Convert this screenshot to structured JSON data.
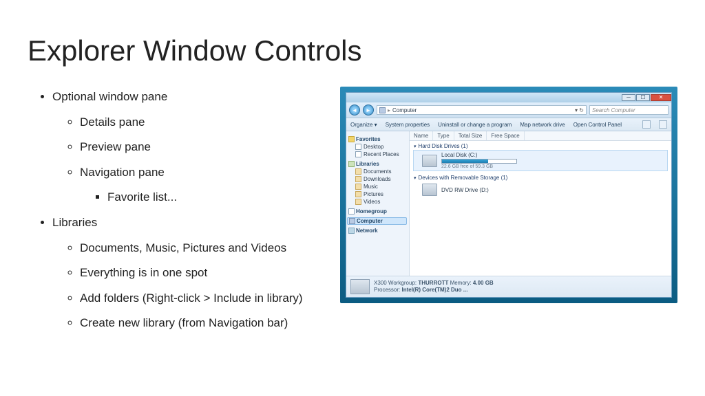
{
  "title": "Explorer Window Controls",
  "bullets": {
    "b1a": "Optional window pane",
    "b2a": "Details pane",
    "b2b": "Preview pane",
    "b2c": "Navigation pane",
    "b3a": "Favorite list...",
    "b1b": "Libraries",
    "b2d": "Documents, Music, Pictures and Videos",
    "b2e": "Everything is in one spot",
    "b2f": "Add folders (Right-click > Include in library)",
    "b2g": "Create new library (from Navigation bar)"
  },
  "explorer": {
    "addrbar": {
      "root_icon": "▸",
      "location": "Computer",
      "search_placeholder": "Search Computer"
    },
    "toolbar": {
      "organize": "Organize ▾",
      "sysprop": "System properties",
      "uninstall": "Uninstall or change a program",
      "mapdrive": "Map network drive",
      "controlpanel": "Open Control Panel"
    },
    "nav": {
      "favorites": "Favorites",
      "desktop": "Desktop",
      "recent": "Recent Places",
      "libraries": "Libraries",
      "documents": "Documents",
      "downloads": "Downloads",
      "music": "Music",
      "pictures": "Pictures",
      "videos": "Videos",
      "homegroup": "Homegroup",
      "computer": "Computer",
      "network": "Network"
    },
    "columns": {
      "name": "Name",
      "type": "Type",
      "total": "Total Size",
      "free": "Free Space"
    },
    "sections": {
      "hdd": "Hard Disk Drives (1)",
      "removable": "Devices with Removable Storage (1)"
    },
    "drives": {
      "c_label": "Local Disk (C:)",
      "c_free": "22.6 GB free of 59.3 GB",
      "c_fill_pct": 62,
      "d_label": "DVD RW Drive (D:)"
    },
    "status": {
      "line1a": "X300  Workgroup: ",
      "line1b": "THURROTT",
      "line1c": "          Memory: ",
      "line1d": "4.00 GB",
      "line2a": "Processor: ",
      "line2b": "Intel(R) Core(TM)2 Duo ..."
    }
  }
}
